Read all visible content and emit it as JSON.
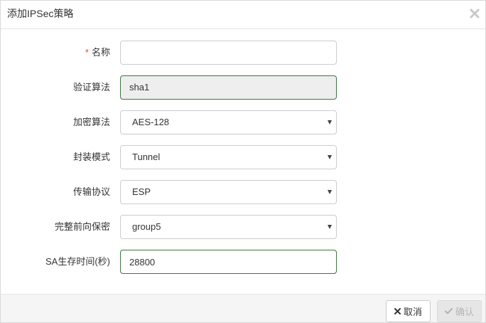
{
  "dialog": {
    "title": "添加IPSec策略",
    "close_icon": "close-icon"
  },
  "form": {
    "name": {
      "required_mark": "*",
      "label": "名称",
      "value": "",
      "placeholder": ""
    },
    "auth_algorithm": {
      "label": "验证算法",
      "value": "sha1"
    },
    "encryption_algorithm": {
      "label": "加密算法",
      "value": "AES-128"
    },
    "encapsulation_mode": {
      "label": "封装模式",
      "value": "Tunnel"
    },
    "transport_protocol": {
      "label": "传输协议",
      "value": "ESP"
    },
    "pfs": {
      "label": "完整前向保密",
      "value": "group5"
    },
    "sa_lifetime": {
      "label": "SA生存时间(秒)",
      "value": "28800"
    }
  },
  "footer": {
    "cancel_label": "取消",
    "confirm_label": "确认"
  },
  "colors": {
    "valid_border": "#3c763d",
    "required": "#e04a3b",
    "readonly_bg": "#eeeeee",
    "footer_bg": "#f5f5f5"
  }
}
